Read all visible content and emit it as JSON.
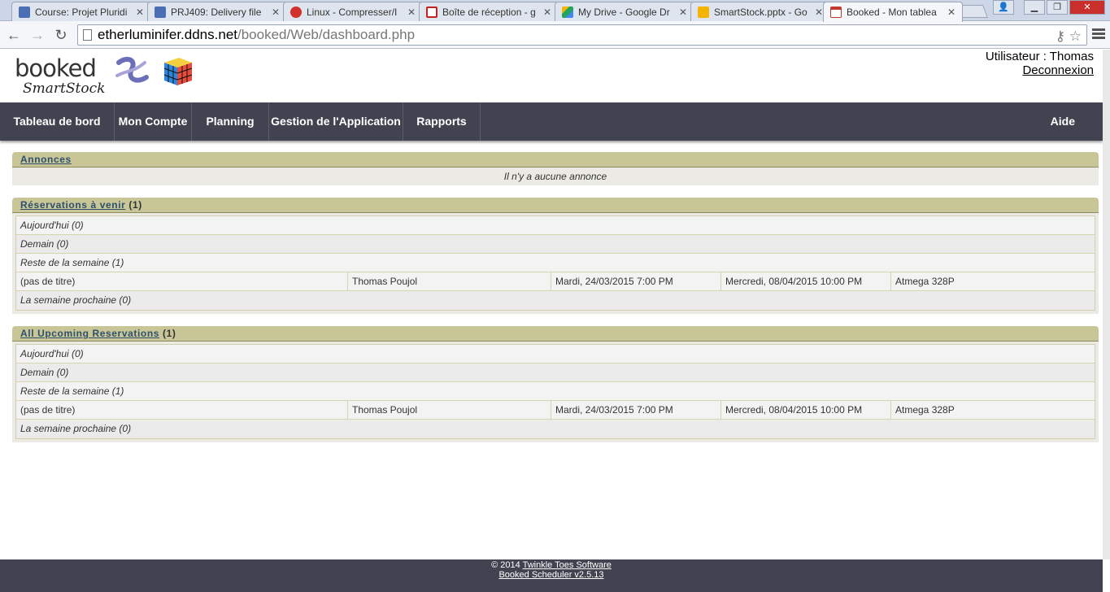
{
  "browser": {
    "tabs": [
      {
        "label": "Course: Projet Pluridi",
        "color": "#4a6fb5"
      },
      {
        "label": "PRJ409: Delivery file",
        "color": "#4a6fb5"
      },
      {
        "label": "Linux - Compresser/I",
        "color": "#d0312d"
      },
      {
        "label": "Boîte de réception - g",
        "color": "#c5221f"
      },
      {
        "label": "My Drive - Google Dr",
        "color": "#1fa463"
      },
      {
        "label": "SmartStock.pptx - Go",
        "color": "#f4b400"
      },
      {
        "label": "Booked - Mon tablea",
        "color": "#c0392b"
      }
    ],
    "url_host": "etherluminifer.ddns.net",
    "url_path": "/booked/Web/dashboard.php"
  },
  "header": {
    "logo_text": "booked",
    "logo_subtext": "SmartStock",
    "user_label": "Utilisateur : Thomas",
    "logout_label": "Deconnexion"
  },
  "nav": {
    "items": [
      "Tableau de bord",
      "Mon Compte",
      "Planning",
      "Gestion de l'Application",
      "Rapports"
    ],
    "help": "Aide"
  },
  "announcements": {
    "title": "Annonces",
    "empty": "Il n'y a aucune annonce"
  },
  "upcoming": {
    "title": "Réservations à venir",
    "count": "(1)",
    "today": "Aujourd'hui (0)",
    "tomorrow": "Demain (0)",
    "rest_of_week": "Reste de la semaine (1)",
    "reservation": {
      "title": "(pas de titre)",
      "user": "Thomas Poujol",
      "start": "Mardi, 24/03/2015 7:00 PM",
      "end": "Mercredi, 08/04/2015 10:00 PM",
      "resource": "Atmega 328P"
    },
    "next_week": "La semaine prochaine (0)"
  },
  "all_upcoming": {
    "title": "All Upcoming Reservations",
    "count": "(1)",
    "today": "Aujourd'hui (0)",
    "tomorrow": "Demain (0)",
    "rest_of_week": "Reste de la semaine (1)",
    "reservation": {
      "title": "(pas de titre)",
      "user": "Thomas Poujol",
      "start": "Mardi, 24/03/2015 7:00 PM",
      "end": "Mercredi, 08/04/2015 10:00 PM",
      "resource": "Atmega 328P"
    },
    "next_week": "La semaine prochaine (0)"
  },
  "footer": {
    "copyright": "© 2014",
    "company": "Twinkle Toes Software",
    "version": "Booked Scheduler v2.5.13"
  }
}
